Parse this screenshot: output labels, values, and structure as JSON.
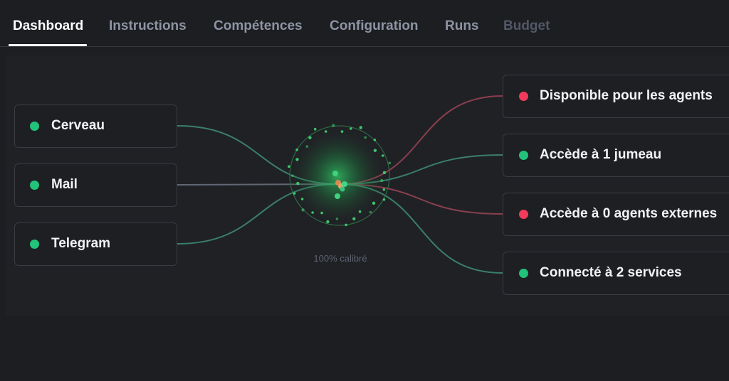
{
  "tabs": [
    {
      "label": "Dashboard",
      "state": "active"
    },
    {
      "label": "Instructions",
      "state": "normal"
    },
    {
      "label": "Compétences",
      "state": "normal"
    },
    {
      "label": "Configuration",
      "state": "normal"
    },
    {
      "label": "Runs",
      "state": "normal"
    },
    {
      "label": "Budget",
      "state": "disabled"
    }
  ],
  "inputs": [
    {
      "label": "Cerveau",
      "status": "green"
    },
    {
      "label": "Mail",
      "status": "green"
    },
    {
      "label": "Telegram",
      "status": "green"
    }
  ],
  "outputs": [
    {
      "label": "Disponible pour les agents",
      "status": "red"
    },
    {
      "label": "Accède à 1 jumeau",
      "status": "green"
    },
    {
      "label": "Accède à 0 agents externes",
      "status": "red"
    },
    {
      "label": "Connecté à 2 services",
      "status": "green"
    }
  ],
  "hub": {
    "calibration_label": "100% calibré",
    "calibration_value": 1.0
  },
  "colors": {
    "green": "#22c27a",
    "red": "#f03b5a",
    "link_green": "#3f8f74",
    "link_red": "#9b4455",
    "link_grey": "#6d7383"
  }
}
